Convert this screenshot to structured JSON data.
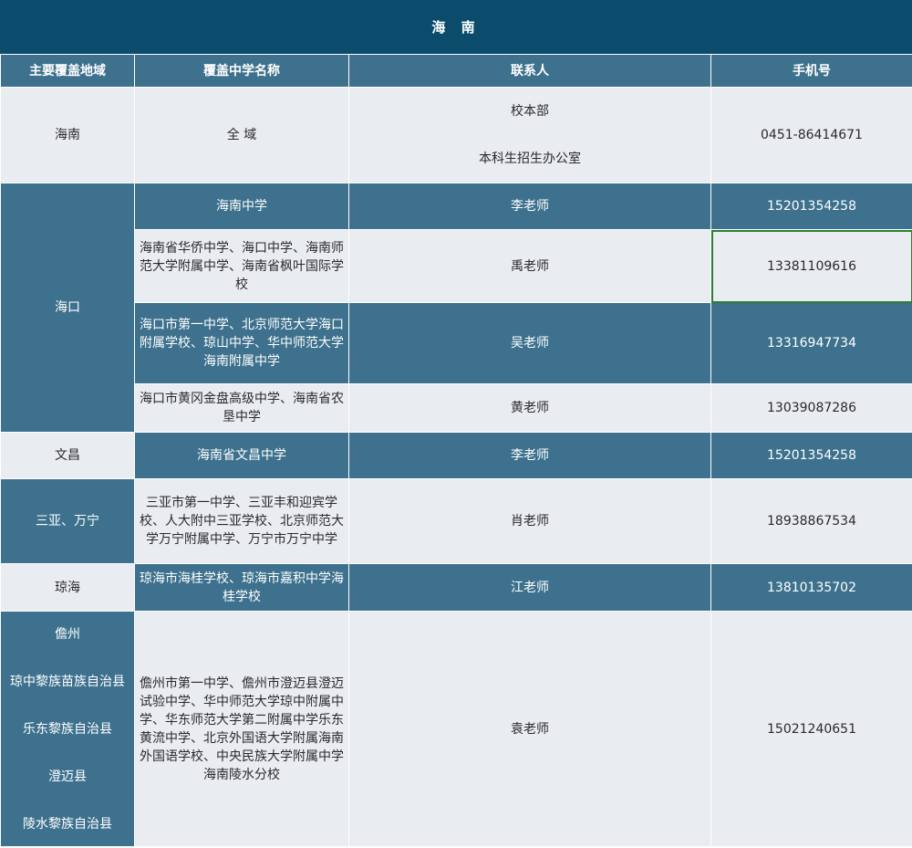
{
  "title": "海 南",
  "columns": [
    "主要覆盖地域",
    "覆盖中学名称",
    "联系人",
    "手机号"
  ],
  "rows": {
    "hainan": {
      "region": "海南",
      "schools": "全 域",
      "contact_line1": "校本部",
      "contact_line2": "本科生招生办公室",
      "phone": "0451-86414671"
    },
    "haikou": {
      "region": "海口",
      "entries": [
        {
          "schools": "海南中学",
          "contact": "李老师",
          "phone": "15201354258"
        },
        {
          "schools": "海南省华侨中学、海口中学、海南师范大学附属中学、海南省枫叶国际学校",
          "contact": "禹老师",
          "phone": "13381109616"
        },
        {
          "schools": "海口市第一中学、北京师范大学海口附属学校、琼山中学、华中师范大学海南附属中学",
          "contact": "吴老师",
          "phone": "13316947734"
        },
        {
          "schools": "海口市黄冈金盘高级中学、海南省农垦中学",
          "contact": "黄老师",
          "phone": "13039087286"
        }
      ]
    },
    "wenchang": {
      "region": "文昌",
      "schools": "海南省文昌中学",
      "contact": "李老师",
      "phone": "15201354258"
    },
    "sanya": {
      "region": "三亚、万宁",
      "schools": "三亚市第一中学、三亚丰和迎宾学校、人大附中三亚学校、北京师范大学万宁附属中学、万宁市万宁中学",
      "contact": "肖老师",
      "phone": "18938867534"
    },
    "qionghai": {
      "region": "琼海",
      "schools": "琼海市海桂学校、琼海市嘉积中学海桂学校",
      "contact": "江老师",
      "phone": "13810135702"
    },
    "danzhou": {
      "regions": [
        "儋州",
        "琼中黎族苗族自治县",
        "乐东黎族自治县",
        "澄迈县",
        "陵水黎族自治县"
      ],
      "schools": "儋州市第一中学、儋州市澄迈县澄迈试验中学、华中师范大学琼中附属中学、华东师范大学第二附属中学乐东黄流中学、北京外国语大学附属海南外国语学校、中央民族大学附属中学海南陵水分校",
      "contact": "袁老师",
      "phone": "15021240651"
    }
  },
  "colors": {
    "banner": "#0b4c6d",
    "header": "#3d718d",
    "dark_row": "#3d718d",
    "light_row": "#e9ecf1"
  }
}
